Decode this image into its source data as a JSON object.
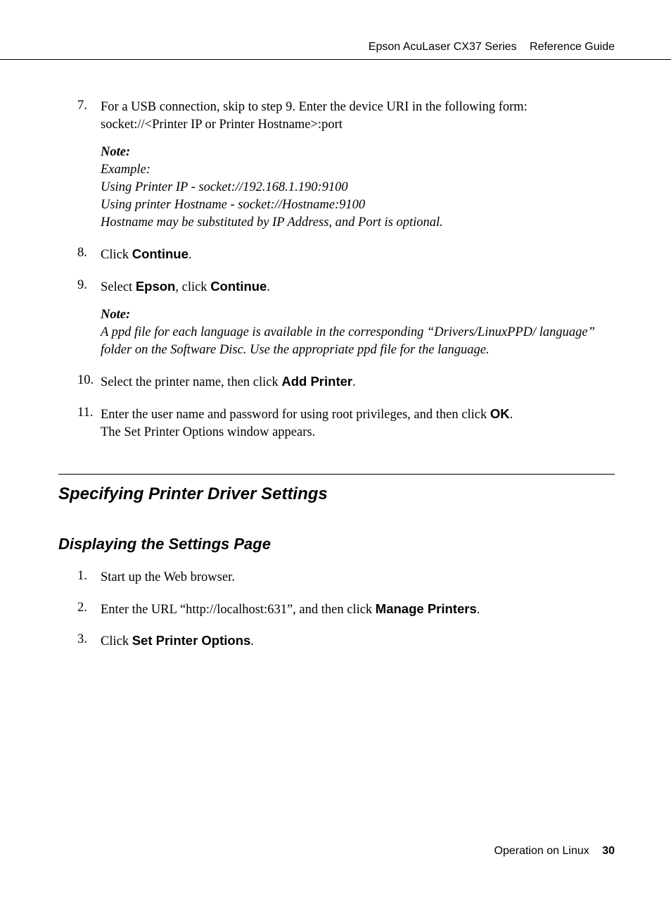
{
  "header": {
    "title": "Epson AcuLaser CX37 Series",
    "doc": "Reference Guide"
  },
  "steps": {
    "s7_num": "7.",
    "s7_a": "For a USB connection, skip to step 9. Enter the device URI in the following form: socket://<Printer IP or Printer Hostname>:port",
    "s7_note_label": "Note:",
    "s7_note_l1": "Example:",
    "s7_note_l2": "Using Printer IP - socket://192.168.1.190:9100",
    "s7_note_l3": "Using printer Hostname - socket://Hostname:9100",
    "s7_note_l4": "Hostname may be substituted by IP Address, and Port is optional.",
    "s8_num": "8.",
    "s8_a": "Click ",
    "s8_b": "Continue",
    "s8_c": ".",
    "s9_num": "9.",
    "s9_a": "Select ",
    "s9_b": "Epson",
    "s9_c": ", click ",
    "s9_d": "Continue",
    "s9_e": ".",
    "s9_note_label": "Note:",
    "s9_note_body": "A ppd file for each language is available in the corresponding “Drivers/LinuxPPD/ language” folder on the Software Disc. Use the appropriate ppd file for the language.",
    "s10_num": "10.",
    "s10_a": "Select the printer name, then click ",
    "s10_b": "Add Printer",
    "s10_c": ".",
    "s11_num": "11.",
    "s11_a": "Enter the user name and password for using root privileges, and then click ",
    "s11_b": "OK",
    "s11_c": ".",
    "s11_d": "The Set Printer Options window appears."
  },
  "sections": {
    "h2": "Specifying Printer Driver Settings",
    "h3": "Displaying the Settings Page",
    "d1_num": "1.",
    "d1_a": "Start up the Web browser.",
    "d2_num": "2.",
    "d2_a": "Enter the URL “http://localhost:631”, and then click ",
    "d2_b": "Manage Printers",
    "d2_c": ".",
    "d3_num": "3.",
    "d3_a": "Click ",
    "d3_b": "Set Printer Options",
    "d3_c": "."
  },
  "footer": {
    "chapter": "Operation on Linux",
    "page": "30"
  }
}
